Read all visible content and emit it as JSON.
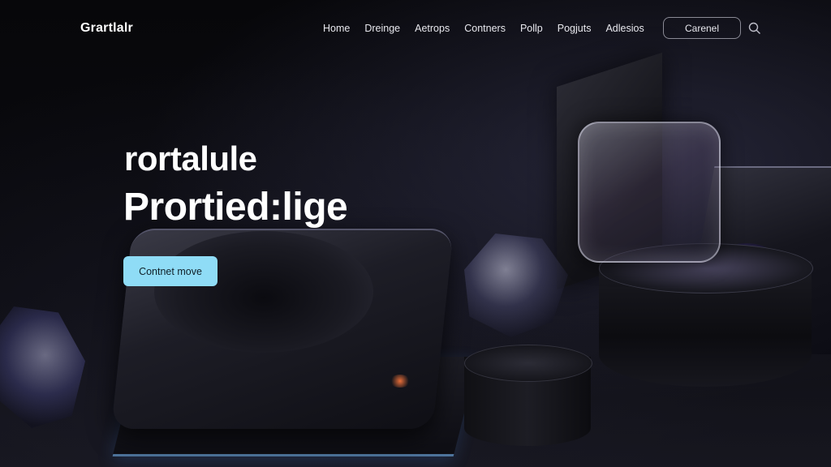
{
  "header": {
    "logo": "Grartlalr",
    "nav_items": [
      "Home",
      "Dreinge",
      "Aetrops",
      "Contners",
      "Pollp",
      "Pogjuts",
      "Adlesios"
    ],
    "search_value": "Carenel"
  },
  "hero": {
    "line1": "rortalule",
    "line2": "Prortied:lige",
    "cta_label": "Contnet move"
  },
  "colors": {
    "background": "#050507",
    "cta": "#8fdcf6",
    "accent_glow": "#6e46ff"
  },
  "icons": {
    "search": "search-icon"
  }
}
